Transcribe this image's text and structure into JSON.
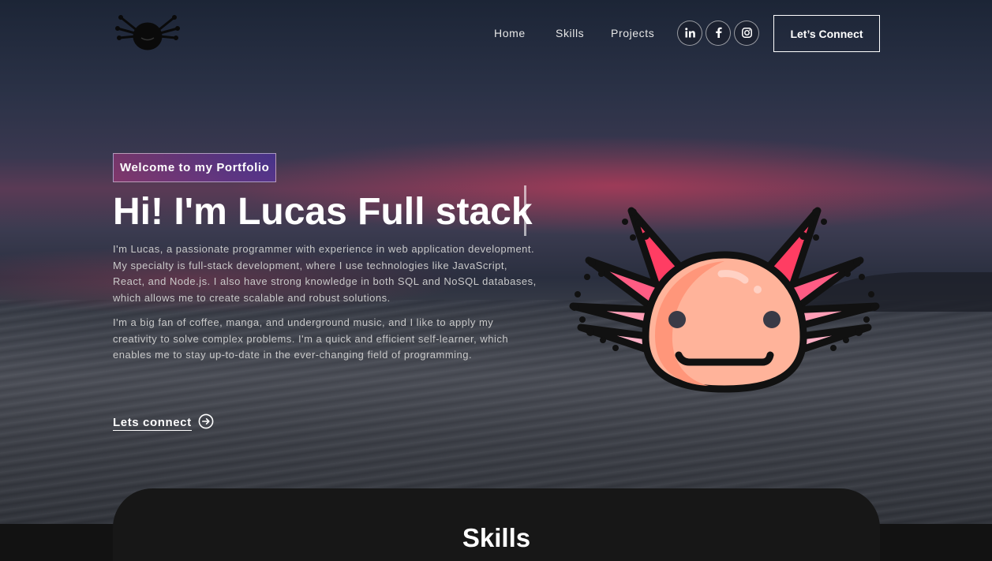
{
  "nav": {
    "links": [
      "Home",
      "Skills",
      "Projects"
    ],
    "social_icons": [
      "linkedin-icon",
      "facebook-icon",
      "instagram-icon"
    ],
    "connect_label": "Let’s Connect"
  },
  "hero": {
    "tagline": "Welcome to my Portfolio",
    "headline": "Hi! I'm Lucas Full stack",
    "paragraph1": "I'm Lucas, a passionate programmer with experience in web application development. My specialty is full-stack development, where I use technologies like JavaScript, React, and Node.js. I also have strong knowledge in both SQL and NoSQL databases, which allows me to create scalable and robust solutions.",
    "paragraph2": "I'm a big fan of coffee, manga, and underground music, and I like to apply my creativity to solve complex problems. I'm a quick and efficient self-learner, which enables me to stay up-to-date in the ever-changing field of programming.",
    "cta_label": "Lets connect",
    "mascot": "axolotl-illustration"
  },
  "skills": {
    "title": "Skills"
  },
  "colors": {
    "tagline_gradient_start": "#aa367c",
    "tagline_gradient_end": "#4a2fbd",
    "section_bg": "#121212"
  }
}
